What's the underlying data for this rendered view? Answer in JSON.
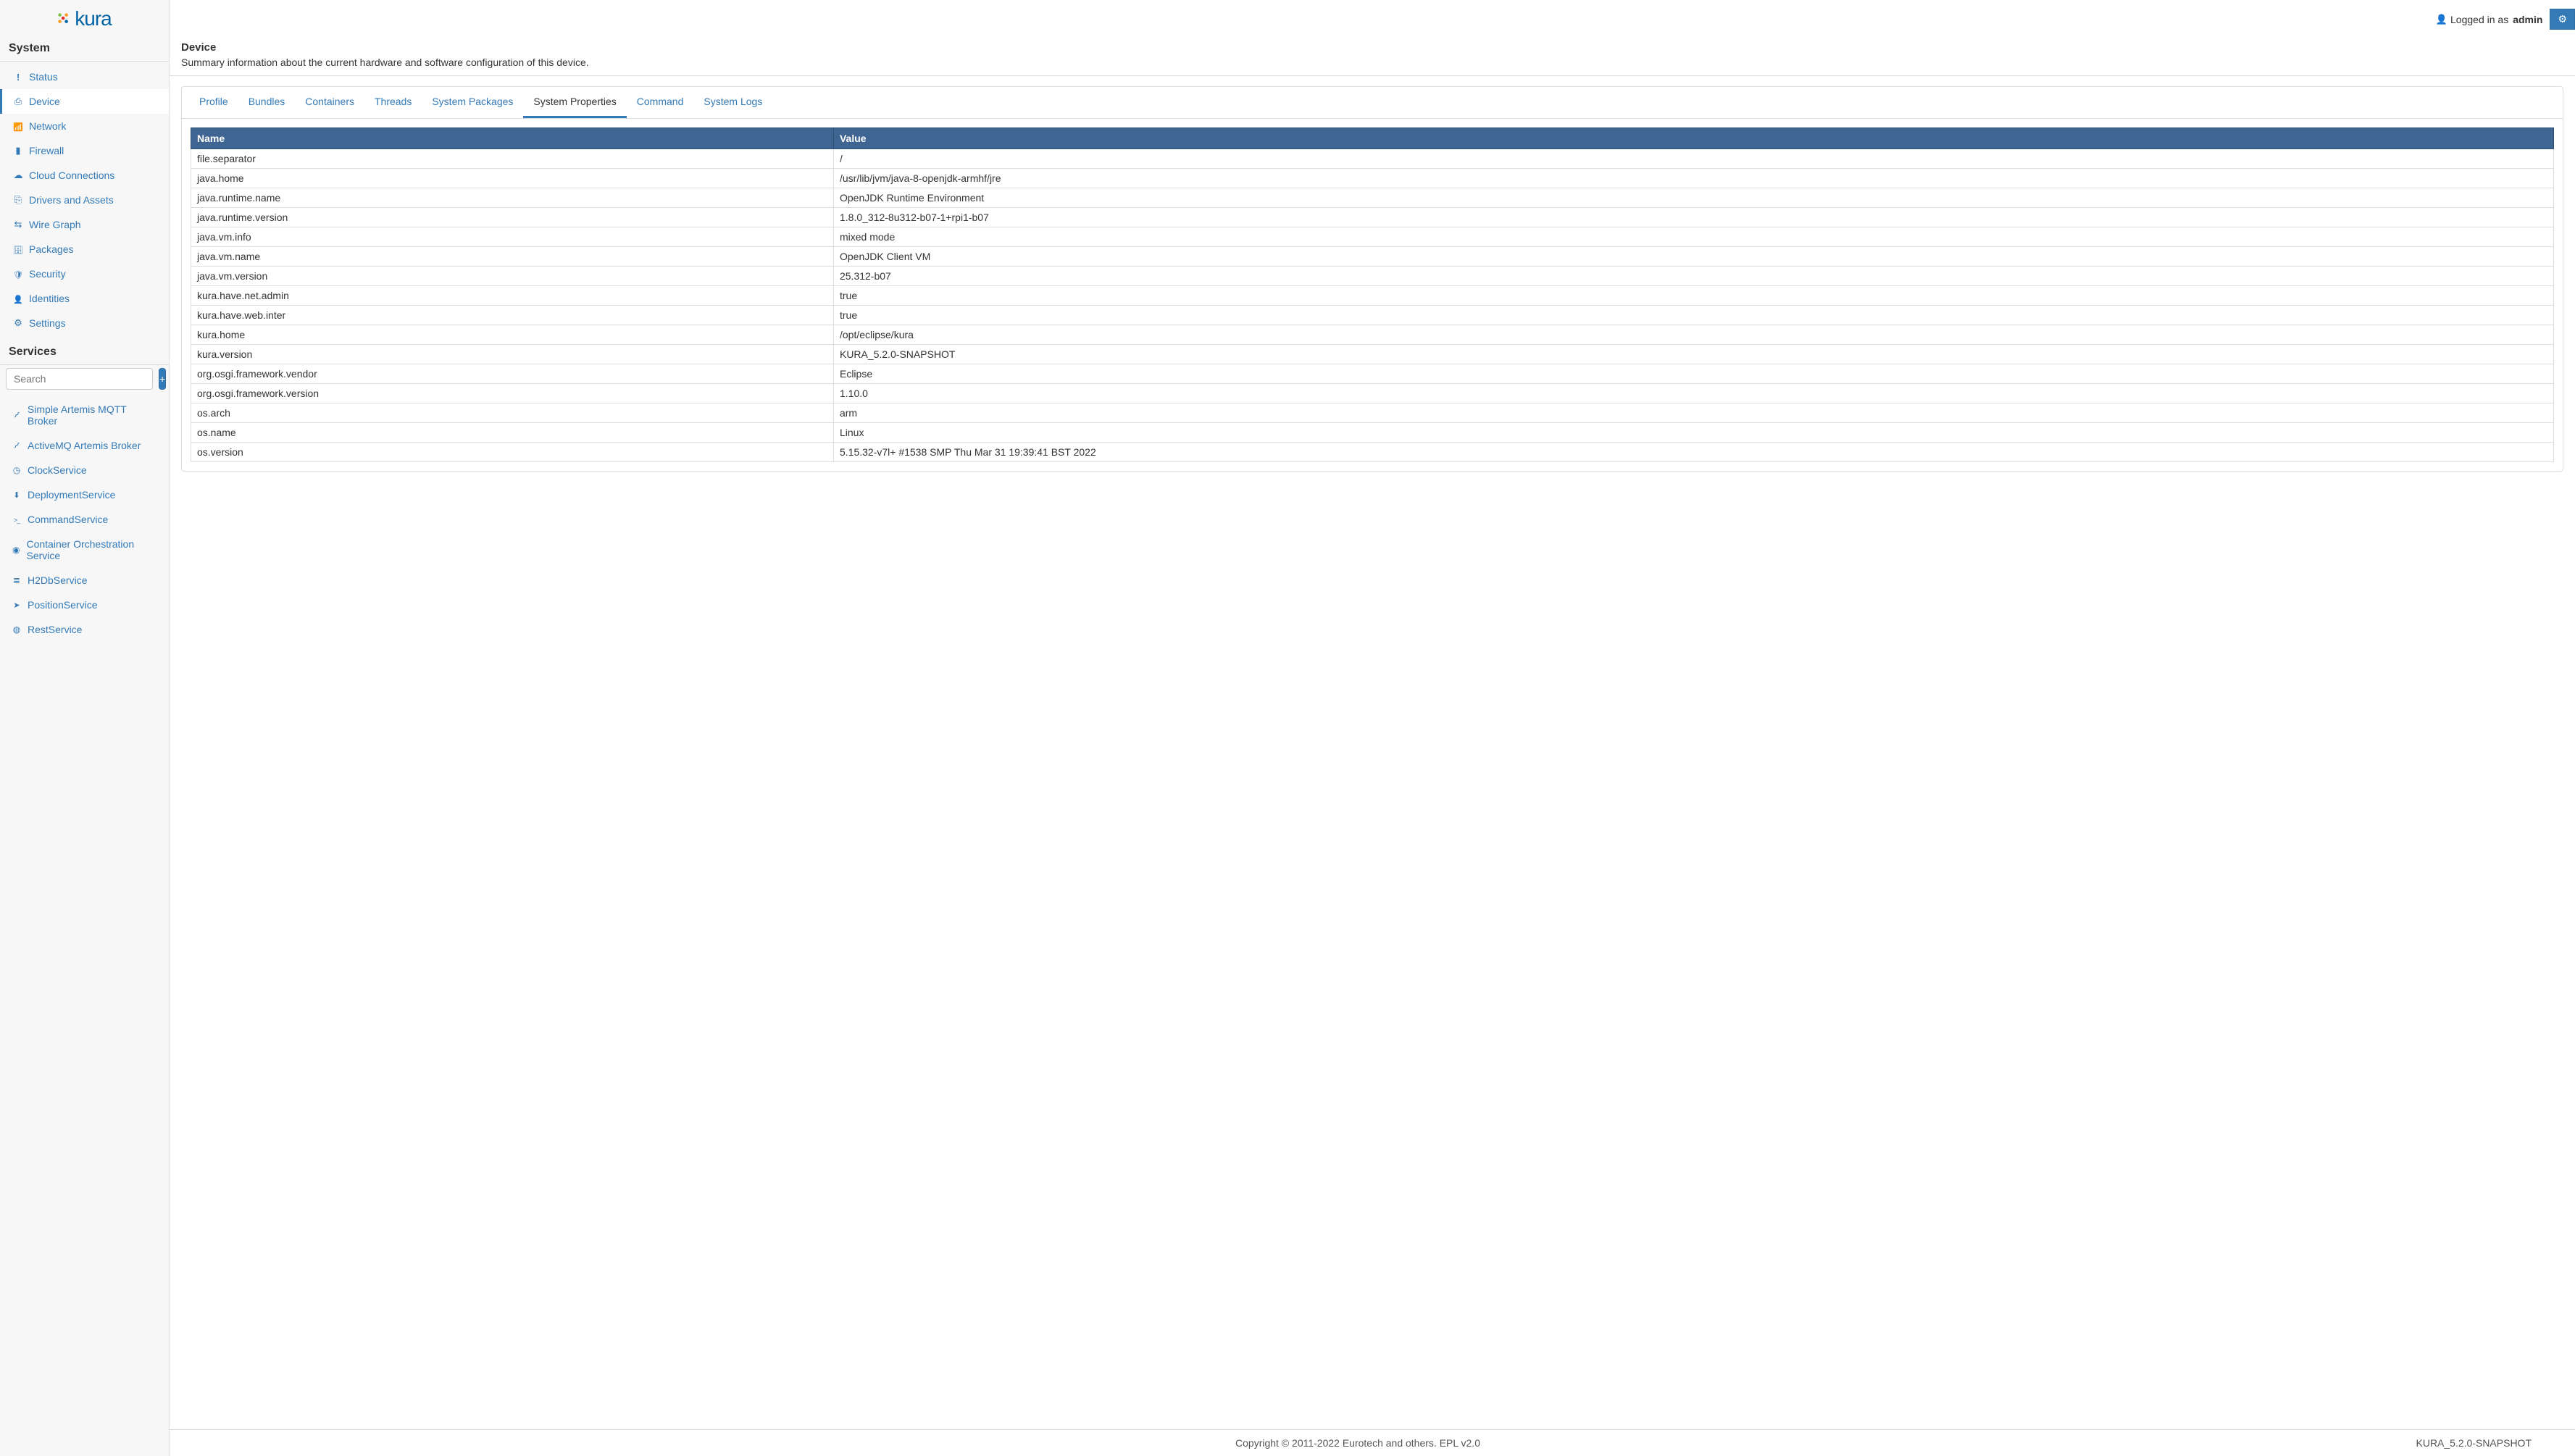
{
  "brand": {
    "name": "kura"
  },
  "topbar": {
    "logged_in_prefix": "Logged in as",
    "username": "admin"
  },
  "sidebar": {
    "system_header": "System",
    "items": [
      {
        "id": "status",
        "label": "Status",
        "icon": "i-status"
      },
      {
        "id": "device",
        "label": "Device",
        "icon": "i-device",
        "active": true
      },
      {
        "id": "network",
        "label": "Network",
        "icon": "i-network"
      },
      {
        "id": "firewall",
        "label": "Firewall",
        "icon": "i-firewall"
      },
      {
        "id": "cloud",
        "label": "Cloud Connections",
        "icon": "i-cloud"
      },
      {
        "id": "drivers",
        "label": "Drivers and Assets",
        "icon": "i-drivers"
      },
      {
        "id": "wire",
        "label": "Wire Graph",
        "icon": "i-wire"
      },
      {
        "id": "packages",
        "label": "Packages",
        "icon": "i-packages"
      },
      {
        "id": "security",
        "label": "Security",
        "icon": "i-security"
      },
      {
        "id": "identities",
        "label": "Identities",
        "icon": "i-identities"
      },
      {
        "id": "settings",
        "label": "Settings",
        "icon": "i-settings"
      }
    ],
    "services_header": "Services",
    "search_placeholder": "Search",
    "services": [
      {
        "id": "artemis-simple",
        "label": "Simple Artemis MQTT Broker",
        "icon": "i-rss"
      },
      {
        "id": "artemis-active",
        "label": "ActiveMQ Artemis Broker",
        "icon": "i-rss"
      },
      {
        "id": "clock",
        "label": "ClockService",
        "icon": "i-clock"
      },
      {
        "id": "deployment",
        "label": "DeploymentService",
        "icon": "i-download"
      },
      {
        "id": "command",
        "label": "CommandService",
        "icon": "i-terminal"
      },
      {
        "id": "container",
        "label": "Container Orchestration Service",
        "icon": "i-container"
      },
      {
        "id": "h2db",
        "label": "H2DbService",
        "icon": "i-db"
      },
      {
        "id": "position",
        "label": "PositionService",
        "icon": "i-position"
      },
      {
        "id": "rest",
        "label": "RestService",
        "icon": "i-rest"
      }
    ]
  },
  "page": {
    "title": "Device",
    "description": "Summary information about the current hardware and software configuration of this device."
  },
  "tabs": [
    {
      "id": "profile",
      "label": "Profile"
    },
    {
      "id": "bundles",
      "label": "Bundles"
    },
    {
      "id": "containers",
      "label": "Containers"
    },
    {
      "id": "threads",
      "label": "Threads"
    },
    {
      "id": "syspkg",
      "label": "System Packages"
    },
    {
      "id": "sysprop",
      "label": "System Properties",
      "active": true
    },
    {
      "id": "command",
      "label": "Command"
    },
    {
      "id": "syslogs",
      "label": "System Logs"
    }
  ],
  "table": {
    "col_name": "Name",
    "col_value": "Value",
    "rows": [
      {
        "name": "file.separator",
        "value": "/"
      },
      {
        "name": "java.home",
        "value": "/usr/lib/jvm/java-8-openjdk-armhf/jre"
      },
      {
        "name": "java.runtime.name",
        "value": "OpenJDK Runtime Environment"
      },
      {
        "name": "java.runtime.version",
        "value": "1.8.0_312-8u312-b07-1+rpi1-b07"
      },
      {
        "name": "java.vm.info",
        "value": "mixed mode"
      },
      {
        "name": "java.vm.name",
        "value": "OpenJDK Client VM"
      },
      {
        "name": "java.vm.version",
        "value": "25.312-b07"
      },
      {
        "name": "kura.have.net.admin",
        "value": "true"
      },
      {
        "name": "kura.have.web.inter",
        "value": "true"
      },
      {
        "name": "kura.home",
        "value": "/opt/eclipse/kura"
      },
      {
        "name": "kura.version",
        "value": "KURA_5.2.0-SNAPSHOT"
      },
      {
        "name": "org.osgi.framework.vendor",
        "value": "Eclipse"
      },
      {
        "name": "org.osgi.framework.version",
        "value": "1.10.0"
      },
      {
        "name": "os.arch",
        "value": "arm"
      },
      {
        "name": "os.name",
        "value": "Linux"
      },
      {
        "name": "os.version",
        "value": "5.15.32-v7l+ #1538 SMP Thu Mar 31 19:39:41 BST 2022"
      }
    ]
  },
  "footer": {
    "copyright": "Copyright © 2011-2022 Eurotech and others. EPL v2.0",
    "version": "KURA_5.2.0-SNAPSHOT"
  }
}
